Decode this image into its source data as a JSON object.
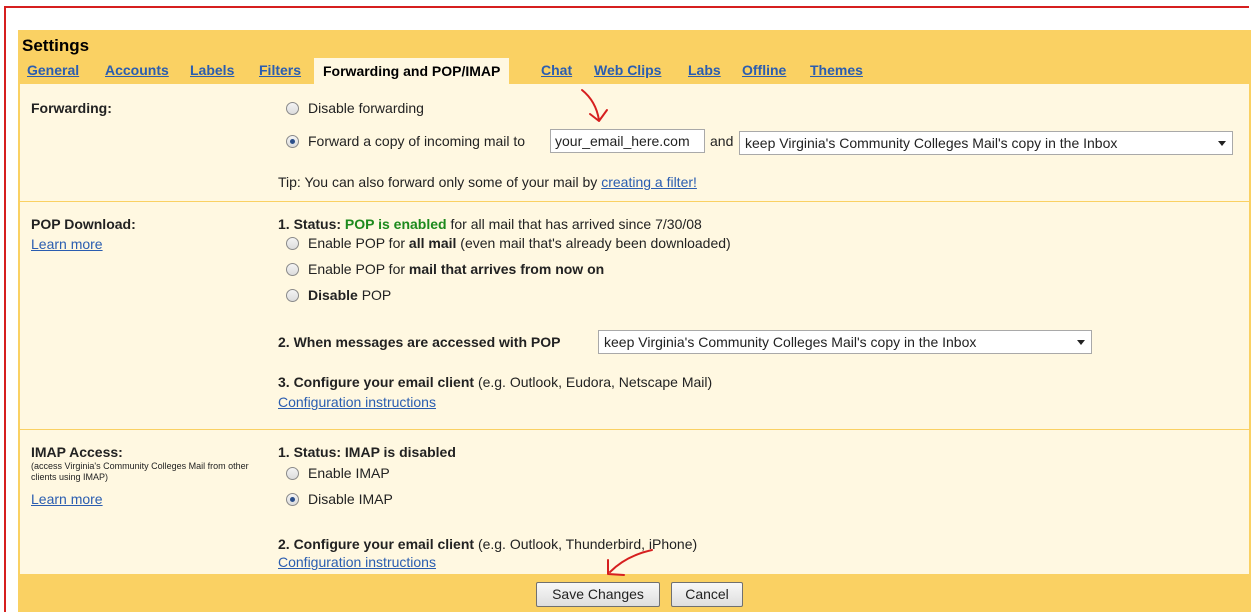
{
  "settings": {
    "title": "Settings"
  },
  "tabs": [
    {
      "label": "General"
    },
    {
      "label": "Accounts"
    },
    {
      "label": "Labels"
    },
    {
      "label": "Filters"
    },
    {
      "label": "Forwarding and POP/IMAP",
      "active": true
    },
    {
      "label": "Chat"
    },
    {
      "label": "Web Clips"
    },
    {
      "label": "Labs"
    },
    {
      "label": "Offline"
    },
    {
      "label": "Themes"
    }
  ],
  "forwarding": {
    "label": "Forwarding:",
    "disable_option": "Disable forwarding",
    "forward_option": "Forward a copy of incoming mail to",
    "email_value": "your_email_here.com",
    "and_text": "and",
    "copy_action": "keep Virginia's Community Colleges Mail's copy in the Inbox",
    "tip_text": "Tip: You can also forward only some of your mail by",
    "tip_link": "creating a filter!",
    "selected": "forward"
  },
  "pop": {
    "label": "POP Download:",
    "learn_more": "Learn more",
    "status_prefix": "1. Status:",
    "status_value": "POP is enabled",
    "status_suffix": "for all mail that has arrived since 7/30/08",
    "option_all_prefix": "Enable POP for",
    "option_all_bold": "all mail",
    "option_all_suffix": "(even mail that's already been downloaded)",
    "option_now_prefix": "Enable POP for",
    "option_now_bold": "mail that arrives from now on",
    "option_disable_bold": "Disable",
    "option_disable_suffix": "POP",
    "when_accessed_label": "2. When messages are accessed with POP",
    "when_accessed_value": "keep Virginia's Community Colleges Mail's copy in the Inbox",
    "configure_bold": "3. Configure your email client",
    "configure_suffix": "(e.g. Outlook, Eudora, Netscape Mail)",
    "config_link": "Configuration instructions"
  },
  "imap": {
    "label": "IMAP Access:",
    "sublabel": "(access Virginia's Community Colleges Mail from other clients using IMAP)",
    "learn_more": "Learn more",
    "status": "1. Status: IMAP is disabled",
    "enable_option": "Enable IMAP",
    "disable_option": "Disable IMAP",
    "selected": "disable",
    "configure_bold": "2. Configure your email client",
    "configure_suffix": "(e.g. Outlook, Thunderbird, iPhone)",
    "config_link": "Configuration instructions"
  },
  "footer": {
    "save_label": "Save Changes",
    "cancel_label": "Cancel"
  },
  "colors": {
    "accent": "#fad163",
    "panel": "#fff8e1",
    "link": "#2a5db0",
    "status_green": "#1d8a1d",
    "annotation_red": "#d61f1f"
  }
}
